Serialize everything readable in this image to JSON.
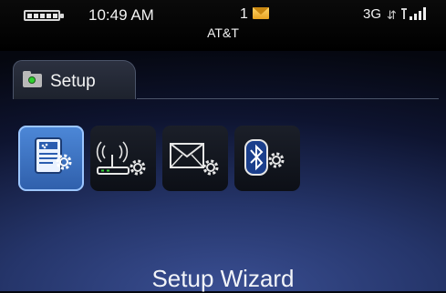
{
  "status_bar": {
    "time": "10:49 AM",
    "message_count": "1",
    "carrier": "AT&T",
    "network_type": "3G",
    "icons": [
      "battery-icon",
      "message-envelope-icon",
      "data-arrows-icon",
      "signal-bars-icon"
    ]
  },
  "tab": {
    "label": "Setup",
    "icon": "folder-icon"
  },
  "app_icons": [
    {
      "name": "setup-wizard-icon",
      "selected": true
    },
    {
      "name": "wireless-network-setup-icon",
      "selected": false
    },
    {
      "name": "email-setup-icon",
      "selected": false
    },
    {
      "name": "bluetooth-setup-icon",
      "selected": false
    }
  ],
  "selected_item_title": "Setup Wizard",
  "colors": {
    "selection_blue": "#3d74c4",
    "background_dark": "#05070f",
    "background_glow": "#3a4f93"
  }
}
